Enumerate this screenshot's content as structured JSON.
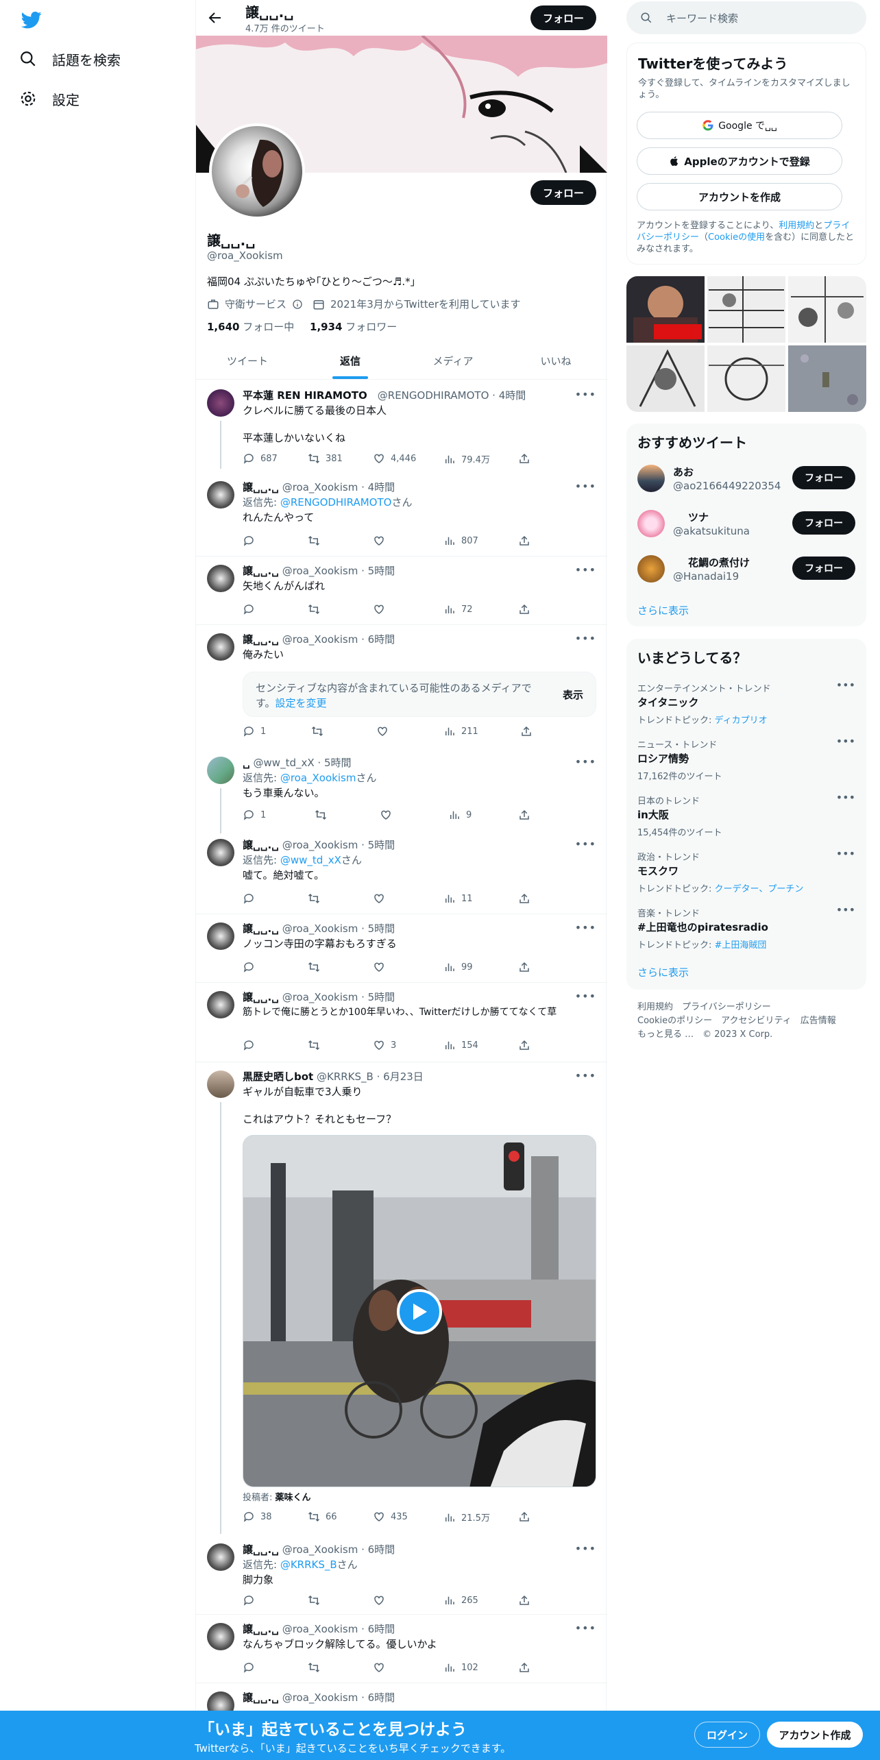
{
  "nav": {
    "explore": "話題を検索",
    "settings": "設定"
  },
  "profile": {
    "name": "譲␣␣.␣",
    "tweet_count": "4.7万 件のツイート",
    "follow": "フォロー",
    "handle": "@roa_Xookism",
    "bio": "福岡04 ぷぷいたちゅや｢ひとり〜ごつ〜♬.*｣",
    "category": "守衛サービス",
    "joined": "2021年3月からTwitterを利用しています",
    "following_count": "1,640",
    "following_label": " フォロー中",
    "followers_count": "1,934",
    "followers_label": " フォロワー"
  },
  "tabs": [
    {
      "label": "ツイート"
    },
    {
      "label": "返信"
    },
    {
      "label": "メディア"
    },
    {
      "label": "いいね"
    }
  ],
  "tweets": [
    {
      "name": "平本蓮 REN HIRAMOTO",
      "handle": "@RENGODHIRAMOTO",
      "time": "4時間",
      "line1": "クレベルに勝てる最後の日本人",
      "line2": "平本蓮しかいないくね",
      "reply": "",
      "rt": "381",
      "like": "4,446",
      "views": "79.4万",
      "reply_count": "687"
    },
    {
      "name": "譲␣␣.␣",
      "handle": "@roa_Xookism",
      "time": "4時間",
      "reply_to_prefix": "返信先: ",
      "reply_to": "@RENGODHIRAMOTO",
      "reply_to_suffix": "さん",
      "text": "れんたんやって",
      "views": "807"
    },
    {
      "name": "譲␣␣.␣",
      "handle": "@roa_Xookism",
      "time": "5時間",
      "text": "矢地くんがんばれ",
      "views": "72"
    },
    {
      "name": "譲␣␣.␣",
      "handle": "@roa_Xookism",
      "time": "6時間",
      "text": "俺みたい",
      "sensitive_1": "センシティブな内容が含まれている可能性のあるメディアで",
      "sensitive_2": "す。",
      "sensitive_link": "設定を変更",
      "show": "表示",
      "reply_count": "1",
      "views": "211"
    },
    {
      "name": "␣",
      "handle": "@ww_td_xX",
      "time": "5時間",
      "reply_to_prefix": "返信先: ",
      "reply_to": "@roa_Xookism",
      "reply_to_suffix": "さん",
      "text": "もう車乗んない。",
      "reply_count": "1",
      "views": "9"
    },
    {
      "name": "譲␣␣.␣",
      "handle": "@roa_Xookism",
      "time": "5時間",
      "reply_to_prefix": "返信先: ",
      "reply_to": "@ww_td_xX",
      "reply_to_suffix": "さん",
      "text": "嘘て。絶対嘘て。",
      "views": "11"
    },
    {
      "name": "譲␣␣.␣",
      "handle": "@roa_Xookism",
      "time": "5時間",
      "text": "ノッコン寺田の字幕おもろすぎる",
      "views": "99"
    },
    {
      "name": "譲␣␣.␣",
      "handle": "@roa_Xookism",
      "time": "5時間",
      "text": "筋トレで俺に勝とうとか100年早いわ、、Twitterだけしか勝ててなくて草",
      "like": "3",
      "views": "154"
    },
    {
      "name": "黒歴史晒しbot",
      "handle": "@KRRKS_B",
      "time": "6月23日",
      "line1": "ギャルが自転車で3人乗り",
      "line2": "これはアウト？それともセーフ？",
      "poster_label": "投稿者: ",
      "poster": "薬味くん",
      "reply_count": "38",
      "rt": "66",
      "like": "435",
      "views": "21.5万"
    },
    {
      "name": "譲␣␣.␣",
      "handle": "@roa_Xookism",
      "time": "6時間",
      "reply_to_prefix": "返信先: ",
      "reply_to": "@KRRKS_B",
      "reply_to_suffix": "さん",
      "text": "脚力象",
      "views": "265"
    },
    {
      "name": "譲␣␣.␣",
      "handle": "@roa_Xookism",
      "time": "6時間",
      "text": "なんちゃブロック解除してる。優しいかよ",
      "views": "102"
    },
    {
      "name": "譲␣␣.␣",
      "handle": "@roa_Xookism",
      "time": "6時間"
    }
  ],
  "right": {
    "search_placeholder": "キーワード検索",
    "signup": {
      "title": "Twitterを使ってみよう",
      "sub": "今すぐ登録して、タイムラインをカスタマイズしましょう。",
      "google": "Google で␣␣",
      "apple": "Appleのアカウントで登録",
      "create": "アカウントを作成",
      "terms_1": "アカウントを登録することにより、",
      "terms_link1": "利用規約",
      "terms_2": "と",
      "terms_link2": "プライバシーポリシー",
      "terms_3": "（",
      "terms_link3": "Cookieの使用",
      "terms_4": "を含む）に同意したとみなされます。"
    },
    "rec": {
      "title": "おすすめツイート",
      "users": [
        {
          "name": "あお",
          "handle": "@ao2166449220354"
        },
        {
          "name": "ツナ",
          "handle": "@akatsukituna"
        },
        {
          "name": "花鯛の煮付け",
          "handle": "@Hanadai19"
        }
      ],
      "follow": "フォロー",
      "more": "さらに表示"
    },
    "trends": {
      "title": "いまどうしてる？",
      "items": [
        {
          "cat": "エンターテインメント・トレンド",
          "name": "タイタニック",
          "sub_label": "トレンドトピック: ",
          "sub_link": "ディカプリオ"
        },
        {
          "cat": "ニュース・トレンド",
          "name": "ロシア情勢",
          "sub": "17,162件のツイート"
        },
        {
          "cat": "日本のトレンド",
          "name": "in大阪",
          "sub": "15,454件のツイート"
        },
        {
          "cat": "政治・トレンド",
          "name": "モスクワ",
          "sub_label": "トレンドトピック: ",
          "sub_link": "クーデター、プーチン"
        },
        {
          "cat": "音楽・トレンド",
          "name": "#上田竜也のpiratesradio",
          "sub_label": "トレンドトピック: ",
          "sub_link": "#上田海賊団"
        }
      ],
      "more": "さらに表示"
    },
    "footer": {
      "l1": "利用規約",
      "l2": "プライバシーポリシー",
      "l3": "Cookieのポリシー",
      "l4": "アクセシビリティ",
      "l5": "広告情報",
      "l6": "もっと見る …",
      "copyright": "© 2023 X Corp."
    }
  },
  "bottom": {
    "title": "「いま」起きていることを見つけよう",
    "sub": "Twitterなら、「いま」起きていることをいち早くチェックできます。",
    "login": "ログイン",
    "signup": "アカウント作成"
  }
}
